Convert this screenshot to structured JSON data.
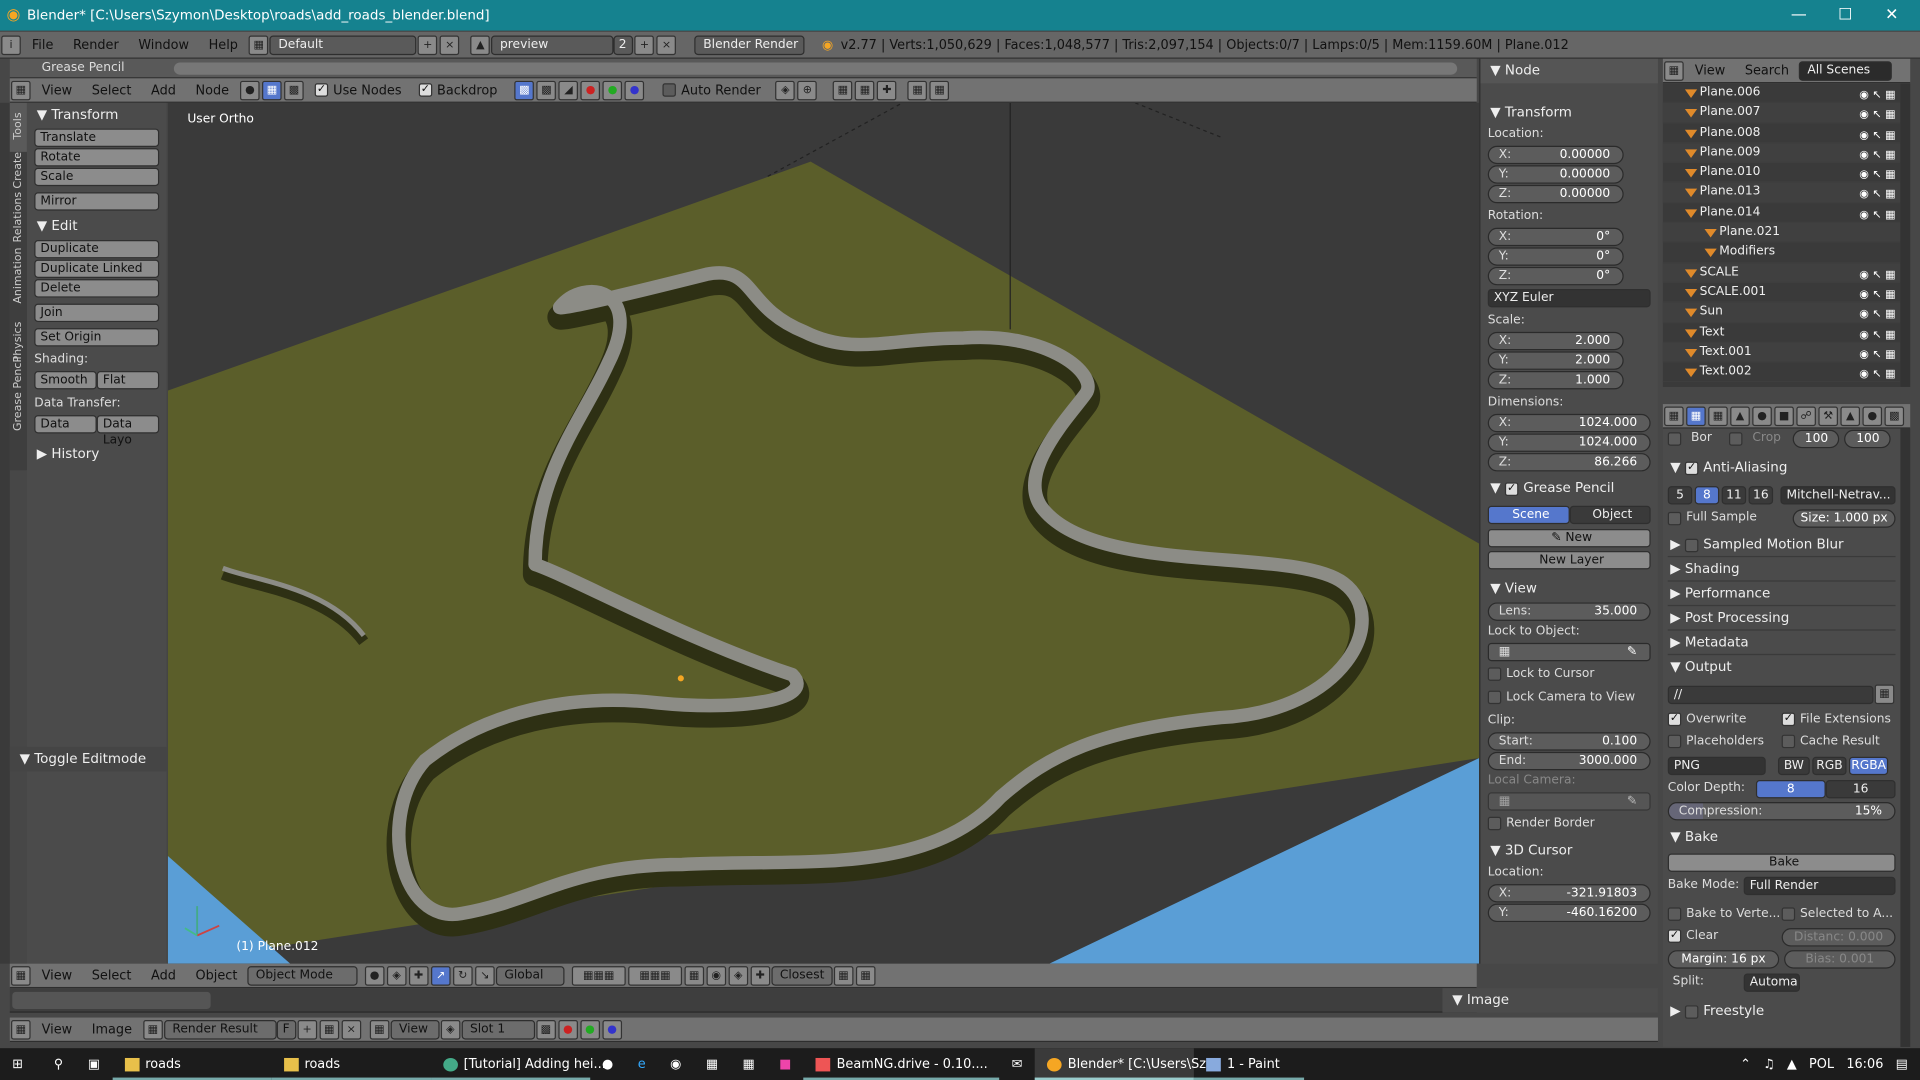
{
  "title": "Blender* [C:\\Users\\Szymon\\Desktop\\roads\\add_roads_blender.blend]",
  "menu": {
    "file": "File",
    "render": "Render",
    "window": "Window",
    "help": "Help"
  },
  "screen_layout": "Default",
  "scene": "preview",
  "scene_users": "2",
  "engine": "Blender Render",
  "stats": "v2.77 | Verts:1,050,629 | Faces:1,048,577 | Tris:2,097,154 | Objects:0/7 | Lamps:0/5 | Mem:1159.60M | Plane.012",
  "node_header": {
    "view": "View",
    "select": "Select",
    "add": "Add",
    "node": "Node",
    "use_nodes": "Use Nodes",
    "backdrop": "Backdrop",
    "auto_render": "Auto Render"
  },
  "grease_pencil_bar": "Grease Pencil",
  "viewport_label": "User Ortho",
  "active_object": "(1) Plane.012",
  "tools": {
    "transform": "Transform",
    "translate": "Translate",
    "rotate": "Rotate",
    "scale": "Scale",
    "mirror": "Mirror",
    "edit": "Edit",
    "duplicate": "Duplicate",
    "duplicate_linked": "Duplicate Linked",
    "delete": "Delete",
    "join": "Join",
    "set_origin": "Set Origin",
    "shading": "Shading:",
    "smooth": "Smooth",
    "flat": "Flat",
    "data_transfer": "Data Transfer:",
    "data": "Data",
    "data_layout": "Data Layo",
    "history": "History",
    "toggle_editmode": "Toggle Editmode"
  },
  "vtabs": [
    "Tools",
    "Create",
    "Relations",
    "Animation",
    "Physics",
    "Grease Pencil"
  ],
  "npanel": {
    "node": "Node",
    "transform": "Transform",
    "location": "Location:",
    "loc_x": "0.00000",
    "loc_y": "0.00000",
    "loc_z": "0.00000",
    "rotation": "Rotation:",
    "rot_x": "0°",
    "rot_y": "0°",
    "rot_z": "0°",
    "euler": "XYZ Euler",
    "scale": "Scale:",
    "sc_x": "2.000",
    "sc_y": "2.000",
    "sc_z": "1.000",
    "dimensions": "Dimensions:",
    "dim_x": "1024.000",
    "dim_y": "1024.000",
    "dim_z": "86.266",
    "grease_pencil": "Grease Pencil",
    "scene": "Scene",
    "object": "Object",
    "new": "New",
    "new_layer": "New Layer",
    "view": "View",
    "lens": "Lens:",
    "lens_val": "35.000",
    "lock_to_object": "Lock to Object:",
    "lock_to_cursor": "Lock to Cursor",
    "lock_camera": "Lock Camera to View",
    "clip": "Clip:",
    "start": "Start:",
    "start_val": "0.100",
    "end": "End:",
    "end_val": "3000.000",
    "local_camera": "Local Camera:",
    "render_border": "Render Border",
    "cursor3d": "3D Cursor",
    "cursor_location": "Location:",
    "cur_x": "-321.91803",
    "cur_y": "-460.16200"
  },
  "outliner": {
    "view": "View",
    "search": "Search",
    "all_scenes": "All Scenes",
    "items": [
      "Plane.006",
      "Plane.007",
      "Plane.008",
      "Plane.009",
      "Plane.010",
      "Plane.013",
      "Plane.014",
      "Plane.021",
      "Modifiers",
      "SCALE",
      "SCALE.001",
      "Sun",
      "Text",
      "Text.001",
      "Text.002"
    ]
  },
  "props": {
    "border": "Bor",
    "crop": "Crop",
    "res_x": "100",
    "res_y": "100",
    "anti_aliasing": "Anti-Aliasing",
    "aa_samples": [
      "5",
      "8",
      "11",
      "16"
    ],
    "aa_filter": "Mitchell-Netrav...",
    "full_sample": "Full Sample",
    "size": "Size: 1.000 px",
    "sampled_motion_blur": "Sampled Motion Blur",
    "shading": "Shading",
    "performance": "Performance",
    "post_processing": "Post Processing",
    "metadata": "Metadata",
    "output": "Output",
    "output_path": "//",
    "overwrite": "Overwrite",
    "file_extensions": "File Extensions",
    "placeholders": "Placeholders",
    "cache_result": "Cache Result",
    "format": "PNG",
    "bw": "BW",
    "rgb": "RGB",
    "rgba": "RGBA",
    "color_depth": "Color Depth:",
    "depth_8": "8",
    "depth_16": "16",
    "compression": "Compression:",
    "compression_val": "15%",
    "bake": "Bake",
    "bake_btn": "Bake",
    "bake_mode": "Bake Mode:",
    "bake_mode_val": "Full Render",
    "bake_to_vertex": "Bake to Verte...",
    "selected_to_active": "Selected to A...",
    "clear": "Clear",
    "distance": "Distanc: 0.000",
    "margin": "Margin:",
    "margin_val": "16 px",
    "bias": "Bias:",
    "bias_val": "0.001",
    "split": "Split:",
    "split_val": "Automa",
    "freestyle": "Freestyle"
  },
  "viewport_header": {
    "view": "View",
    "select": "Select",
    "add": "Add",
    "object": "Object",
    "mode": "Object Mode",
    "orientation": "Global",
    "snap": "Closest"
  },
  "image_editor": {
    "view": "View",
    "image": "Image",
    "image_name": "Render Result",
    "f": "F",
    "view2": "View",
    "slot": "Slot 1",
    "image_panel": "Image"
  },
  "taskbar": {
    "items": [
      "roads",
      "roads",
      "[Tutorial] Adding hei...",
      "BeamNG.drive - 0.10....",
      "Blender* [C:\\Users\\Sz...",
      "1 - Paint"
    ],
    "lang": "POL",
    "time": "16:06"
  },
  "colors": {
    "titlebar": "#15828f",
    "selected": "#5577cc",
    "ground": "#5b5e2a",
    "water": "#5a9ed6"
  }
}
